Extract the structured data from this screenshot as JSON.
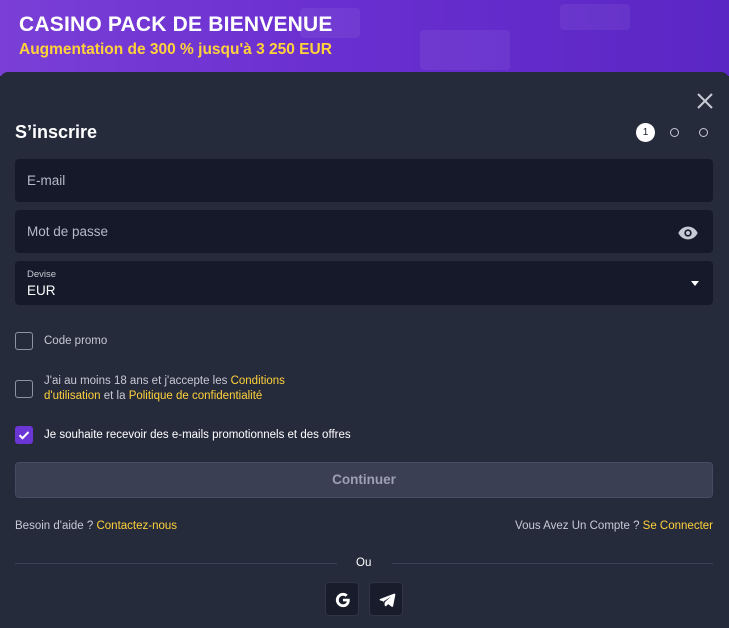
{
  "banner": {
    "title": "CASINO PACK DE BIENVENUE",
    "subtitle": "Augmentation de 300 % jusqu'à 3 250 EUR"
  },
  "modal": {
    "title": "S’inscrire",
    "steps": {
      "current": "1",
      "total": 3
    },
    "email": {
      "placeholder": "E-mail"
    },
    "password": {
      "placeholder": "Mot de passe"
    },
    "currency": {
      "label": "Devise",
      "value": "EUR"
    },
    "promo": {
      "label": "Code promo",
      "checked": false
    },
    "terms": {
      "prefix": "J'ai au moins 18 ans et j'accepte les ",
      "conditions_1": "Conditions",
      "conditions_2": "d'utilisation",
      "middle": " et la ",
      "privacy": "Politique de confidentialité",
      "checked": false
    },
    "marketing": {
      "label": "Je souhaite recevoir des e-mails promotionnels et des offres",
      "checked": true
    },
    "continue_label": "Continuer",
    "help": {
      "text": "Besoin d'aide ? ",
      "link": "Contactez-nous"
    },
    "login": {
      "text": "Vous Avez Un Compte ? ",
      "link": "Se Connecter"
    },
    "or_label": "Ou",
    "social": [
      "google-icon",
      "telegram-icon"
    ]
  },
  "colors": {
    "accent_yellow": "#ffd23a",
    "accent_purple": "#6a37d6",
    "background": "#262b3c",
    "input_bg": "#151929"
  }
}
